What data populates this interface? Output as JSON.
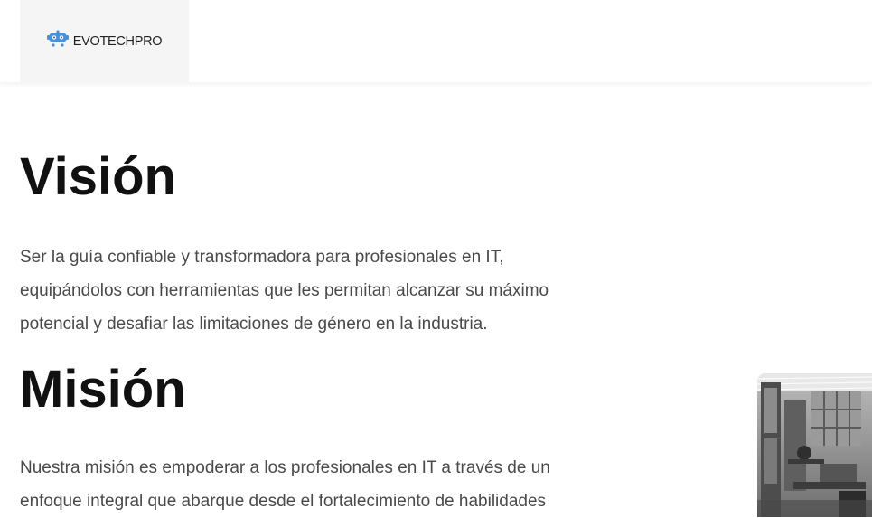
{
  "header": {
    "logo_text": "EVOTECHPRO",
    "logo_icon": "robot-head-icon",
    "logo_color": "#4a90d9"
  },
  "vision": {
    "title": "Visión",
    "text": "Ser la guía confiable y transformadora para profesionales en IT, equipándolos con herramientas que les permitan alcanzar su máximo potencial y desafiar las limitaciones de género en la industria."
  },
  "mision": {
    "title": "Misión",
    "text": "Nuestra misión es empoderar a los profesionales en IT a través de un enfoque integral que abarque desde el fortalecimiento de habilidades"
  }
}
